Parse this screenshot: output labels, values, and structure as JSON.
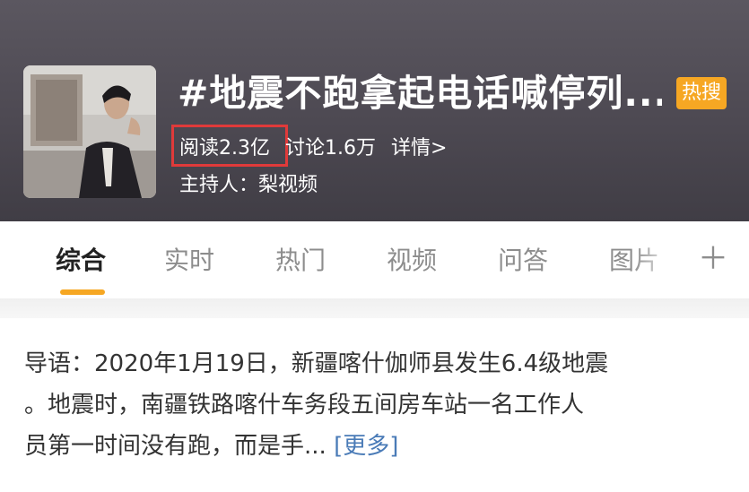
{
  "header": {
    "title": "#地震不跑拿起电话喊停列...",
    "hot_badge": "热搜",
    "stats": {
      "read": "阅读2.3亿",
      "discuss": "讨论1.6万",
      "details": "详情>"
    },
    "host": "主持人：梨视频"
  },
  "tabs": [
    {
      "label": "综合",
      "active": true
    },
    {
      "label": "实时",
      "active": false
    },
    {
      "label": "热门",
      "active": false
    },
    {
      "label": "视频",
      "active": false
    },
    {
      "label": "问答",
      "active": false
    },
    {
      "label": "图片",
      "active": false
    }
  ],
  "tabs_more_icon": "plus-icon",
  "intro": {
    "line1": "导语：2020年1月19日，新疆喀什伽师县发生6.4级地震",
    "line2": "。地震时，南疆铁路喀什车务段五间房车站一名工作人",
    "line3": "员第一时间没有跑，而是手...",
    "more": "[更多]"
  },
  "colors": {
    "accent": "#f6a723",
    "highlight_box": "#e03a3a",
    "link": "#4a7bb7"
  }
}
